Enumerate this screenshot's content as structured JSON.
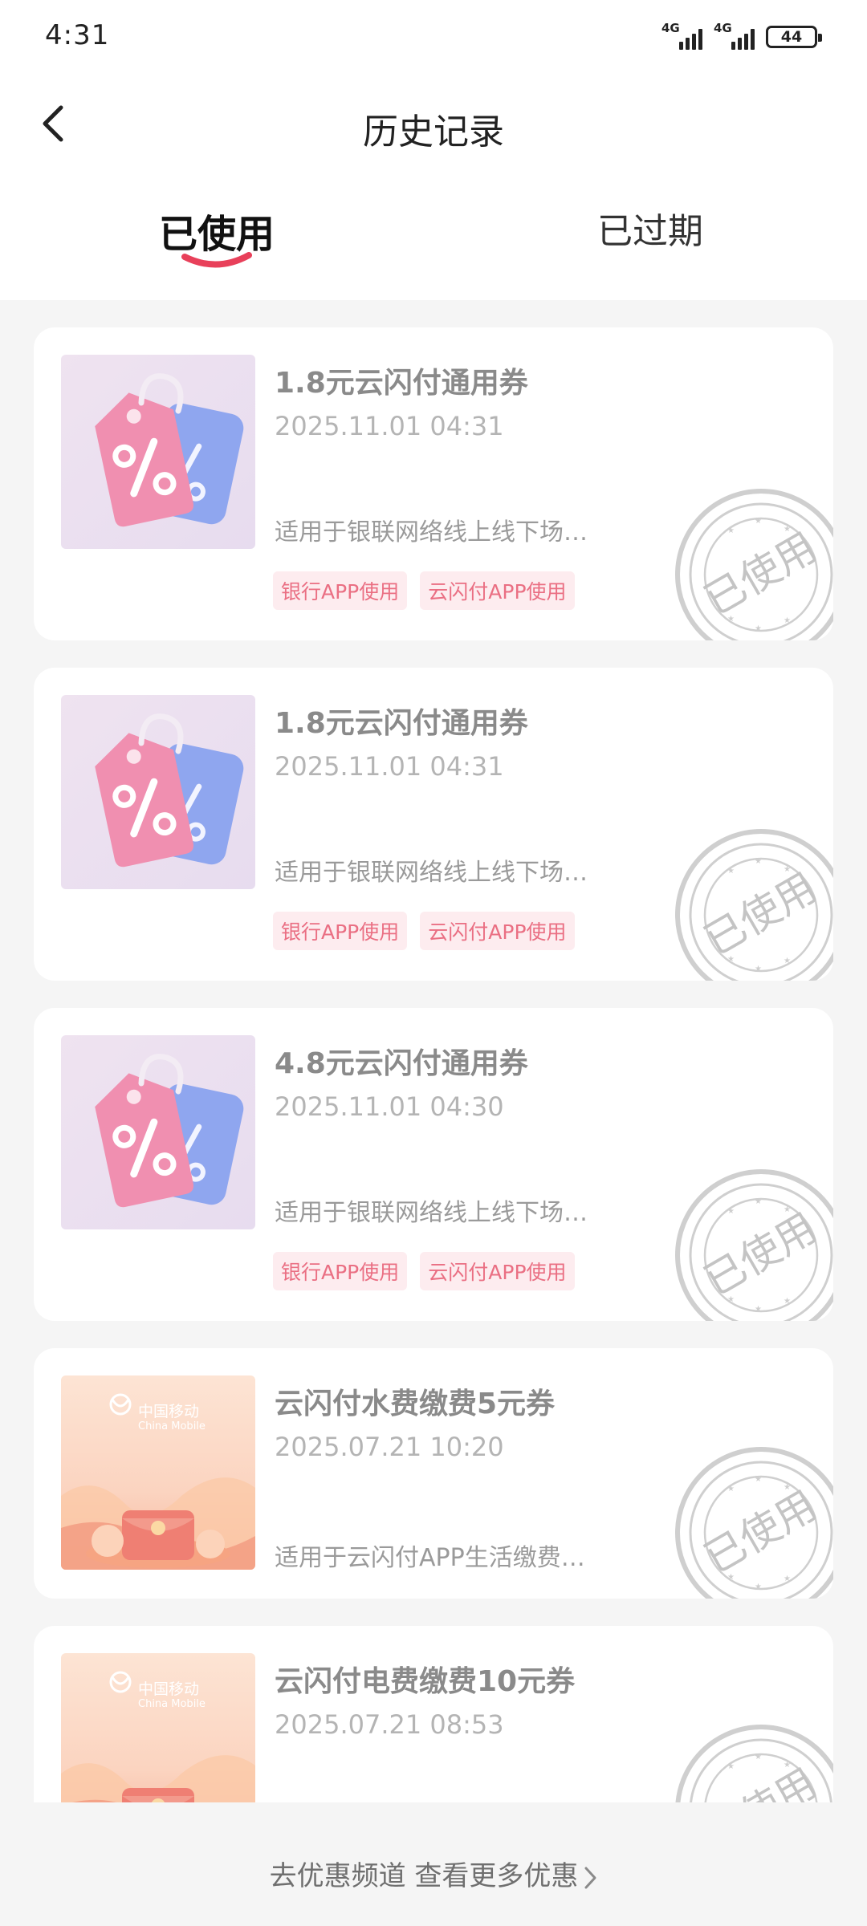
{
  "status_bar": {
    "time": "4:31",
    "network_1": "4G",
    "network_2": "4G",
    "battery": "44"
  },
  "header": {
    "title": "历史记录",
    "back_icon": "chevron-left-icon",
    "tabs": [
      {
        "label": "已使用",
        "active": true
      },
      {
        "label": "已过期",
        "active": false
      }
    ]
  },
  "coupons": [
    {
      "title": "1.8元云闪付通用券",
      "date": "2025.11.01 04:31",
      "description": "适用于银联网络线上线下场…",
      "image": "discount-tag-icon",
      "tags": [
        "银行APP使用",
        "云闪付APP使用"
      ],
      "stamp": "已使用"
    },
    {
      "title": "1.8元云闪付通用券",
      "date": "2025.11.01 04:31",
      "description": "适用于银联网络线上线下场…",
      "image": "discount-tag-icon",
      "tags": [
        "银行APP使用",
        "云闪付APP使用"
      ],
      "stamp": "已使用"
    },
    {
      "title": "4.8元云闪付通用券",
      "date": "2025.11.01 04:30",
      "description": "适用于银联网络线上线下场…",
      "image": "discount-tag-icon",
      "tags": [
        "银行APP使用",
        "云闪付APP使用"
      ],
      "stamp": "已使用"
    },
    {
      "title": "云闪付水费缴费5元券",
      "date": "2025.07.21 10:20",
      "description": "适用于云闪付APP生活缴费…",
      "image": "china-mobile-banner",
      "brand_cn": "中国移动",
      "brand_en": "China Mobile",
      "stamp": "已使用"
    },
    {
      "title": "云闪付电费缴费10元券",
      "date": "2025.07.21 08:53",
      "image": "china-mobile-banner",
      "brand_cn": "中国移动",
      "brand_en": "China Mobile",
      "stamp": "已使用"
    }
  ],
  "footer": {
    "link_text": "去优惠频道 查看更多优惠",
    "chevron_icon": "chevron-right-icon"
  },
  "colors": {
    "accent": "#e8405a",
    "chip_bg": "#fdecef",
    "chip_text": "#ea6f83",
    "page_bg": "#f5f5f5"
  }
}
